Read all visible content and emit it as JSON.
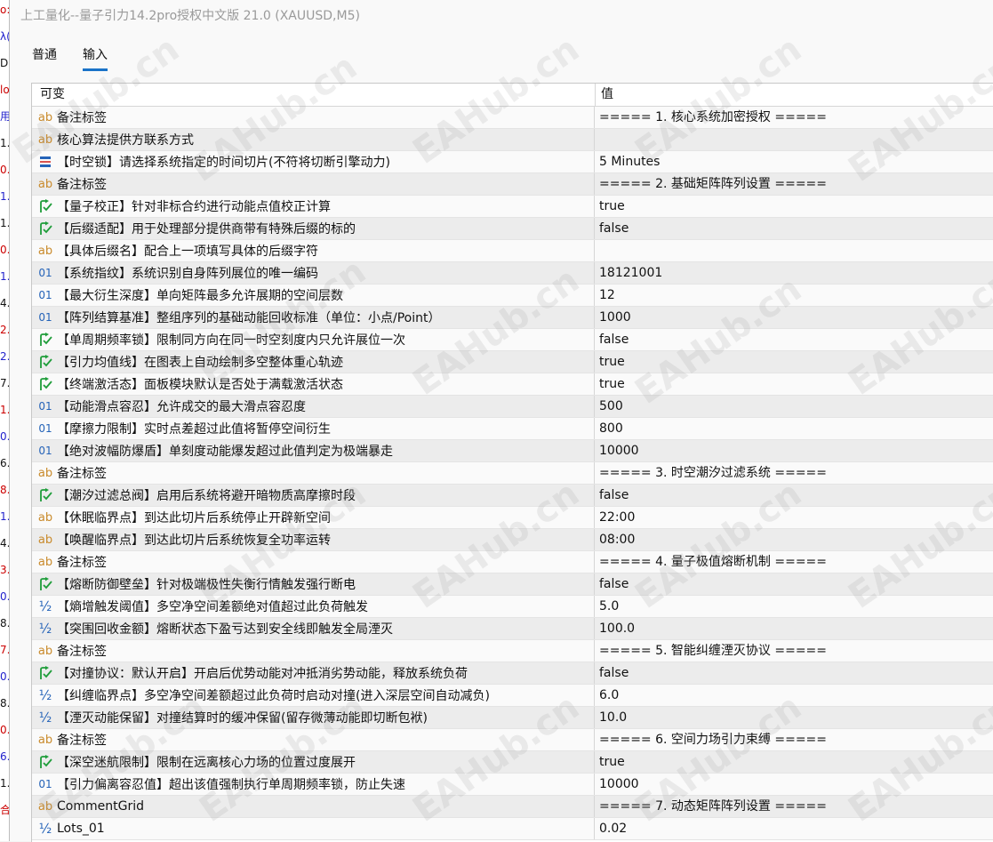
{
  "window": {
    "title": "上工量化--量子引力14.2pro授权中文版 21.0 (XAUUSD,M5)"
  },
  "tabs": [
    {
      "label": "普通",
      "active": false
    },
    {
      "label": "输入",
      "active": true
    }
  ],
  "grid": {
    "columns": [
      "可变",
      "值"
    ],
    "rows": [
      {
        "icon": "ab",
        "name": "备注标签",
        "value": "===== 1. 核心系统加密授权 ====="
      },
      {
        "icon": "ab",
        "name": "核心算法提供方联系方式",
        "value": ""
      },
      {
        "icon": "enum",
        "name": "【时空锁】请选择系统指定的时间切片(不符将切断引擎动力)",
        "value": "5 Minutes"
      },
      {
        "icon": "ab",
        "name": "备注标签",
        "value": "===== 2. 基础矩阵阵列设置 ====="
      },
      {
        "icon": "bool",
        "name": "【量子校正】针对非标合约进行动能点值校正计算",
        "value": "true"
      },
      {
        "icon": "bool",
        "name": "【后缀适配】用于处理部分提供商带有特殊后缀的标的",
        "value": "false"
      },
      {
        "icon": "ab",
        "name": "【具体后缀名】配合上一项填写具体的后缀字符",
        "value": ""
      },
      {
        "icon": "int",
        "name": "【系统指纹】系统识别自身阵列展位的唯一编码",
        "value": "18121001"
      },
      {
        "icon": "int",
        "name": "【最大衍生深度】单向矩阵最多允许展期的空间层数",
        "value": "12"
      },
      {
        "icon": "int",
        "name": "【阵列结算基准】整组序列的基础动能回收标准（单位：小点/Point）",
        "value": "1000"
      },
      {
        "icon": "bool",
        "name": "【单周期频率锁】限制同方向在同一时空刻度内只允许展位一次",
        "value": "false"
      },
      {
        "icon": "bool",
        "name": "【引力均值线】在图表上自动绘制多空整体重心轨迹",
        "value": "true"
      },
      {
        "icon": "bool",
        "name": "【终端激活态】面板模块默认是否处于满载激活状态",
        "value": "true"
      },
      {
        "icon": "int",
        "name": "【动能滑点容忍】允许成交的最大滑点容忍度",
        "value": "500"
      },
      {
        "icon": "int",
        "name": "【摩擦力限制】实时点差超过此值将暂停空间衍生",
        "value": "800"
      },
      {
        "icon": "int",
        "name": "【绝对波幅防爆盾】单刻度动能爆发超过此值判定为极端暴走",
        "value": "10000"
      },
      {
        "icon": "ab",
        "name": "备注标签",
        "value": "===== 3. 时空潮汐过滤系统 ====="
      },
      {
        "icon": "bool",
        "name": "【潮汐过滤总阀】启用后系统将避开暗物质高摩擦时段",
        "value": "false"
      },
      {
        "icon": "ab",
        "name": "【休眠临界点】到达此切片后系统停止开辟新空间",
        "value": "22:00"
      },
      {
        "icon": "ab",
        "name": "【唤醒临界点】到达此切片后系统恢复全功率运转",
        "value": "08:00"
      },
      {
        "icon": "ab",
        "name": "备注标签",
        "value": "===== 4. 量子极值熔断机制 ====="
      },
      {
        "icon": "bool",
        "name": "【熔断防御壁垒】针对极端极性失衡行情触发强行断电",
        "value": "false"
      },
      {
        "icon": "dbl",
        "name": "【熵增触发阈值】多空净空间差额绝对值超过此负荷触发",
        "value": "5.0"
      },
      {
        "icon": "dbl",
        "name": "【突围回收金额】熔断状态下盈亏达到安全线即触发全局湮灭",
        "value": "100.0"
      },
      {
        "icon": "ab",
        "name": "备注标签",
        "value": "===== 5. 智能纠缠湮灭协议 ====="
      },
      {
        "icon": "bool",
        "name": "【对撞协议：默认开启】开启后优势动能对冲抵消劣势动能，释放系统负荷",
        "value": "false"
      },
      {
        "icon": "dbl",
        "name": "【纠缠临界点】多空净空间差额超过此负荷时启动对撞(进入深层空间自动减负)",
        "value": "6.0"
      },
      {
        "icon": "dbl",
        "name": "【湮灭动能保留】对撞结算时的缓冲保留(留存微薄动能即切断包袱)",
        "value": "10.0"
      },
      {
        "icon": "ab",
        "name": "备注标签",
        "value": "===== 6. 空间力场引力束缚 ====="
      },
      {
        "icon": "bool",
        "name": "【深空迷航限制】限制在远离核心力场的位置过度展开",
        "value": "true"
      },
      {
        "icon": "int",
        "name": "【引力偏离容忍值】超出该值强制执行单周期频率锁，防止失速",
        "value": "10000"
      },
      {
        "icon": "ab",
        "name": "CommentGrid",
        "value": "===== 7. 动态矩阵阵列设置 ====="
      },
      {
        "icon": "dbl",
        "name": "Lots_01",
        "value": "0.02"
      }
    ]
  },
  "watermark": "EAHub.cn",
  "left_strip": [
    "o:",
    "λ(",
    "DE",
    "lo",
    "用.",
    "1.",
    "0.",
    "1.",
    "1.",
    "0.",
    "1.",
    "4.",
    "2.",
    "2.",
    "7.",
    "1.",
    "0.",
    "6.",
    "8.",
    "1.",
    "4.",
    "3.",
    "0.",
    "8.",
    "7.",
    "0.",
    "8.",
    "0.",
    "6.",
    "1.",
    "合"
  ],
  "colors": {
    "accent": "#1a73c8",
    "string_icon": "#c98a2b",
    "number_icon": "#2563b8",
    "bool_icon": "#1f9d3a"
  }
}
